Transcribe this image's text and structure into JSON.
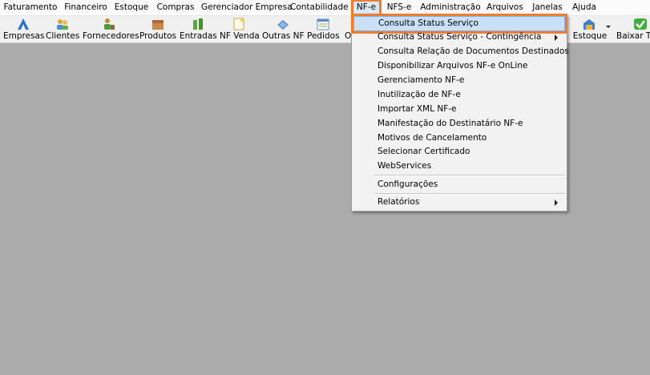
{
  "menubar": {
    "items": [
      "Faturamento",
      "Financeiro",
      "Estoque",
      "Compras",
      "Gerenciador Empresa",
      "Contabilidade",
      "NF-e",
      "NFS-e",
      "Administração",
      "Arquivos",
      "Janelas",
      "Ajuda"
    ]
  },
  "toolbar": {
    "items": [
      {
        "label": "Empresas",
        "icon": "empresas-icon"
      },
      {
        "label": "Clientes",
        "icon": "clientes-icon"
      },
      {
        "label": "Fornecedores",
        "icon": "fornecedores-icon"
      },
      {
        "label": "Produtos",
        "icon": "produtos-icon"
      },
      {
        "label": "Entradas",
        "icon": "entradas-icon"
      },
      {
        "label": "NF Venda",
        "icon": "nf-venda-icon"
      },
      {
        "label": "Outras NF",
        "icon": "outras-nf-icon"
      },
      {
        "label": "Pedidos",
        "icon": "pedidos-icon"
      },
      {
        "label": "Or",
        "icon": "orcamento-icon"
      },
      {
        "label": "Estoque",
        "icon": "estoque-icon"
      },
      {
        "label": "Baixar Tít",
        "icon": "baixar-titulos-icon"
      }
    ]
  },
  "nfe_menu": {
    "items": [
      {
        "label": "Consulta Status Serviço",
        "submenu": false
      },
      {
        "label": "Consulta Status Serviço - Contingência",
        "submenu": true
      },
      {
        "label": "Consulta Relação de Documentos Destinados",
        "submenu": false
      },
      {
        "label": "Disponibilizar Arquivos NF-e OnLine",
        "submenu": false
      },
      {
        "label": "Gerenciamento NF-e",
        "submenu": false
      },
      {
        "label": "Inutilização de NF-e",
        "submenu": false
      },
      {
        "label": "Importar XML NF-e",
        "submenu": false
      },
      {
        "label": "Manifestação do Destinatário NF-e",
        "submenu": false
      },
      {
        "label": "Motivos de Cancelamento",
        "submenu": false
      },
      {
        "label": "Selecionar Certificado",
        "submenu": false
      },
      {
        "label": "WebServices",
        "submenu": false
      },
      {
        "label": "Configurações",
        "submenu": false
      },
      {
        "label": "Relatórios",
        "submenu": true
      }
    ]
  },
  "colors": {
    "highlight": "#ef7d31",
    "workspace": "#ababab"
  }
}
